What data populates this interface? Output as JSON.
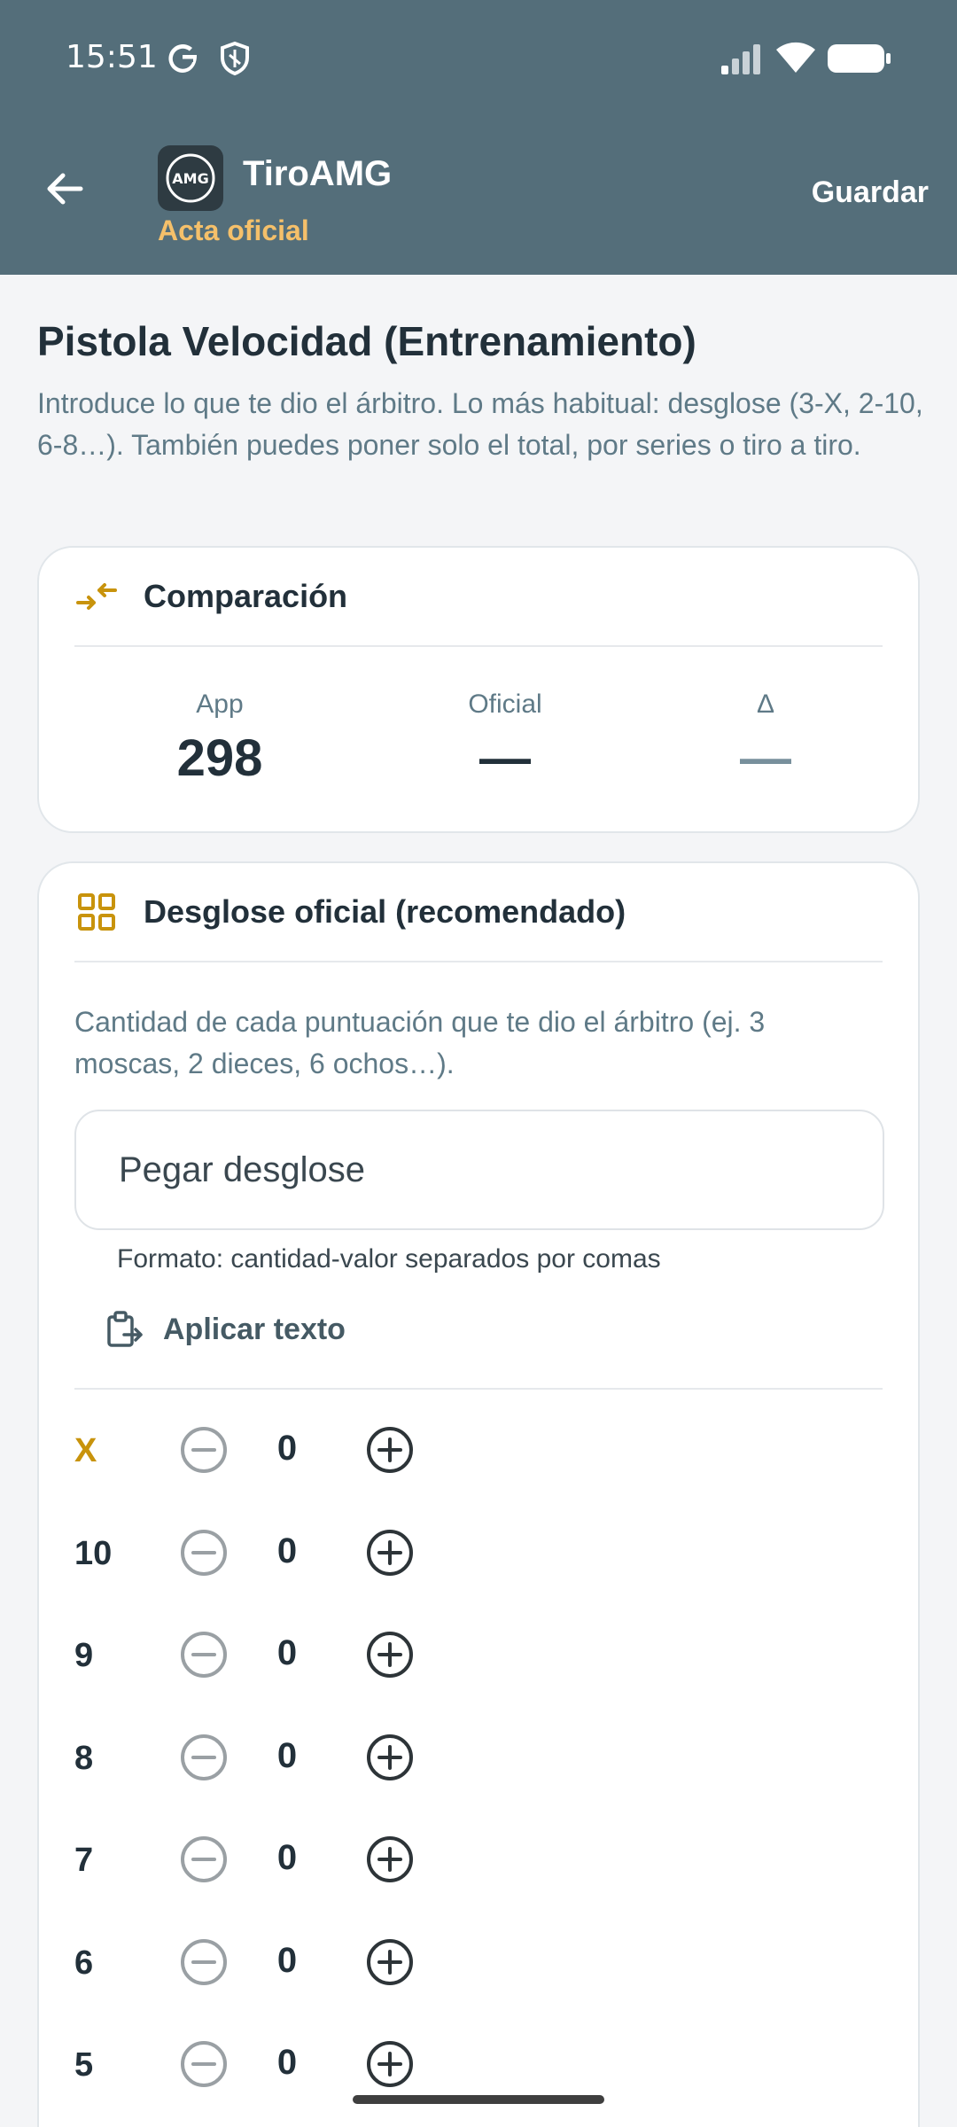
{
  "status_bar": {
    "time": "15:51",
    "icons": [
      "google-icon",
      "shield-icon",
      "signal-icon",
      "wifi-icon",
      "battery-icon"
    ]
  },
  "app_bar": {
    "title": "TiroAMG",
    "subtitle": "Acta oficial",
    "logo_text": "AMG",
    "save_label": "Guardar",
    "colors": {
      "bar": "#546e7a",
      "subtitle": "#f5c06a"
    }
  },
  "page": {
    "title": "Pistola Velocidad (Entrenamiento)",
    "description": "Introduce lo que te dio el árbitro. Lo más habitual: desglose (3-X, 2-10, 6-8…). También puedes poner solo el total, por series o tiro a tiro."
  },
  "comparison": {
    "title": "Comparación",
    "app_label": "App",
    "app_value": "298",
    "official_label": "Oficial",
    "official_value": "—",
    "delta_label": "Δ",
    "delta_value": "—"
  },
  "breakdown": {
    "title": "Desglose oficial (recomendado)",
    "help": "Cantidad de cada puntuación que te dio el árbitro (ej. 3 moscas, 2 dieces, 6 ochos…).",
    "paste_placeholder": "Pegar desglose",
    "paste_value": "",
    "format_hint": "Formato: cantidad-valor separados por comas",
    "apply_label": "Aplicar texto",
    "accent": "#c8930c",
    "rows": [
      {
        "label": "X",
        "count": "0"
      },
      {
        "label": "10",
        "count": "0"
      },
      {
        "label": "9",
        "count": "0"
      },
      {
        "label": "8",
        "count": "0"
      },
      {
        "label": "7",
        "count": "0"
      },
      {
        "label": "6",
        "count": "0"
      },
      {
        "label": "5",
        "count": "0"
      }
    ]
  }
}
